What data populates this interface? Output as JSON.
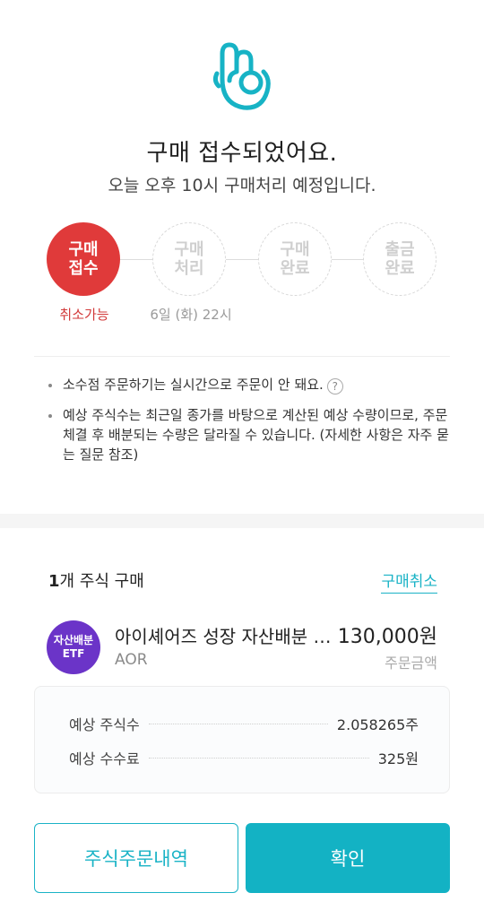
{
  "header": {
    "title": "구매 접수되었어요.",
    "subtitle": "오늘 오후 10시 구매처리 예정입니다.",
    "icon": "ok-hand-icon"
  },
  "steps": [
    {
      "label": "구매\n접수",
      "state": "active"
    },
    {
      "label": "구매\n처리",
      "state": "pending"
    },
    {
      "label": "구매\n완료",
      "state": "pending"
    },
    {
      "label": "출금\n완료",
      "state": "pending"
    }
  ],
  "step_notes": {
    "cancelable": "취소가능",
    "scheduled_time": "6일 (화) 22시"
  },
  "notes": [
    "소수점 주문하기는 실시간으로 주문이 안 돼요.",
    "예상 주식수는 최근일 종가를 바탕으로 계산된 예상 수량이므로, 주문체결 후 배분되는 수량은 달라질 수 있습니다. (자세한 사항은 자주 묻는 질문 참조)"
  ],
  "order": {
    "count_number": "1",
    "count_suffix": "개 주식 구매",
    "cancel_link": "구매취소"
  },
  "stock": {
    "badge_line1": "자산배분",
    "badge_line2": "ETF",
    "name": "아이셰어즈 성장 자산배분 ETF",
    "ticker": "AOR",
    "amount": "130,000원",
    "amount_label": "주문금액"
  },
  "summary": {
    "shares_label": "예상 주식수",
    "shares_value": "2.058265주",
    "fee_label": "예상 수수료",
    "fee_value": "325원"
  },
  "buttons": {
    "history": "주식주문내역",
    "confirm": "확인"
  },
  "colors": {
    "accent": "#13b2c4",
    "active_step": "#e03a3a",
    "etf_badge": "#6b34c8"
  }
}
